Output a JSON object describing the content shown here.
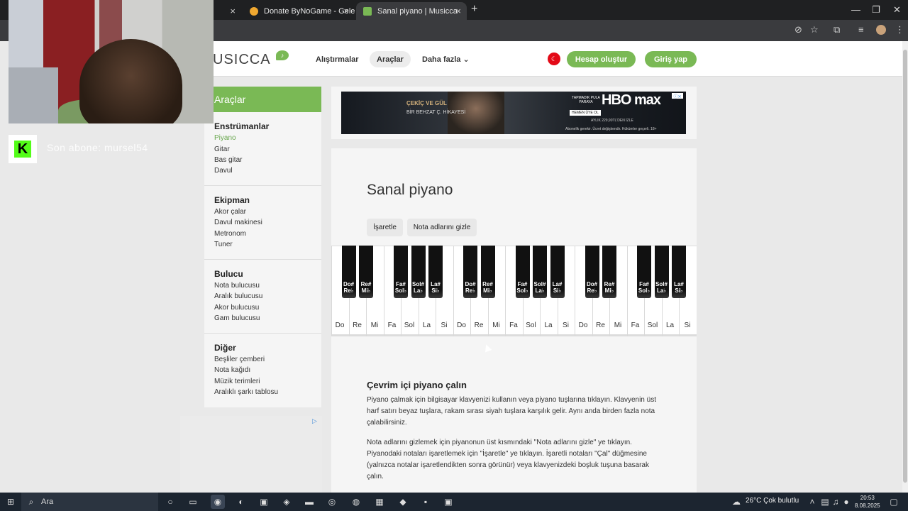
{
  "browser": {
    "tabs": [
      {
        "label": "",
        "active": false
      },
      {
        "label": "Donate ByNoGame - Gelen/Gi",
        "active": false
      },
      {
        "label": "Sanal piyano | Musicca",
        "active": true
      }
    ],
    "new_tab": "+",
    "close_glyph": "×",
    "window_controls": [
      "—",
      "❐",
      "✕"
    ]
  },
  "overlay": {
    "sub_label": "Son abone: mursel54",
    "kick_logo": "K"
  },
  "site": {
    "logo": "USICCA",
    "nav": [
      "Alıştırmalar",
      "Araçlar",
      "Daha fazla ⌄"
    ],
    "signup": "Hesap oluştur",
    "login": "Giriş yap"
  },
  "sidebar": {
    "title": "Araçlar",
    "sections": [
      {
        "title": "Enstrümanlar",
        "items": [
          "Piyano",
          "Gitar",
          "Bas gitar",
          "Davul"
        ]
      },
      {
        "title": "Ekipman",
        "items": [
          "Akor çalar",
          "Davul makinesi",
          "Metronom",
          "Tuner"
        ]
      },
      {
        "title": "Bulucu",
        "items": [
          "Nota bulucusu",
          "Aralık bulucusu",
          "Akor bulucusu",
          "Gam bulucusu"
        ]
      },
      {
        "title": "Diğer",
        "items": [
          "Beşliler çemberi",
          "Nota kağıdı",
          "Müzik terimleri",
          "Aralıklı şarkı tablosu"
        ]
      }
    ]
  },
  "ad": {
    "line1": "ÇEKİÇ VE GÜL",
    "line2": "BİR BEHZAT Ç. HİKAYESİ",
    "offer": "TAPMADIK PULA PARAYA",
    "cta": "HEMEN ÜYE OL",
    "brand": "HBO max",
    "price": "AYLIK 229,90TL'DEN İZLE",
    "disclaimer": "Abonelik gerekir. Ücret değişkendir. Hükümler geçerli. 18+"
  },
  "page": {
    "title": "Sanal piyano",
    "mark_button": "İşaretle",
    "hide_button": "Nota adlarını gizle",
    "white_keys": [
      "Do",
      "Re",
      "Mi",
      "Fa",
      "Sol",
      "La",
      "Si",
      "Do",
      "Re",
      "Mi",
      "Fa",
      "Sol",
      "La",
      "Si",
      "Do",
      "Re",
      "Mi",
      "Fa",
      "Sol",
      "La",
      "Si"
    ],
    "black_keys": [
      {
        "top": "Do#",
        "bottom": "Re♭"
      },
      {
        "top": "Re#",
        "bottom": "Mi♭"
      },
      {
        "top": "Fa#",
        "bottom": "Sol♭"
      },
      {
        "top": "Sol#",
        "bottom": "La♭"
      },
      {
        "top": "La#",
        "bottom": "Si♭"
      },
      {
        "top": "Do#",
        "bottom": "Re♭"
      },
      {
        "top": "Re#",
        "bottom": "Mi♭"
      },
      {
        "top": "Fa#",
        "bottom": "Sol♭"
      },
      {
        "top": "Sol#",
        "bottom": "La♭"
      },
      {
        "top": "La#",
        "bottom": "Si♭"
      },
      {
        "top": "Do#",
        "bottom": "Re♭"
      },
      {
        "top": "Re#",
        "bottom": "Mi♭"
      },
      {
        "top": "Fa#",
        "bottom": "Sol♭"
      },
      {
        "top": "Sol#",
        "bottom": "La♭"
      },
      {
        "top": "La#",
        "bottom": "Si♭"
      }
    ],
    "heading": "Çevrim içi piyano çalın",
    "para1": "Piyano çalmak için bilgisayar klavyenizi kullanın veya piyano tuşlarına tıklayın. Klavyenin üst harf satırı beyaz tuşlara, rakam sırası siyah tuşlara karşılık gelir. Aynı anda birden fazla nota çalabilirsiniz.",
    "para2": "Nota adlarını gizlemek için piyanonun üst kısmındaki \"Nota adlarını gizle\" ye tıklayın. Piyanodaki notaları işaretlemek için \"İşaretle\" ye tıklayın. İşaretli notaları \"Çal\" düğmesine (yalnızca notalar işaretlendikten sonra görünür) veya klavyenizdeki boşluk tuşuna basarak çalın."
  },
  "taskbar": {
    "search": "Ara",
    "weather": "26°C  Çok bulutlu",
    "time": "20:53",
    "date": "8.08.2025"
  },
  "colors": {
    "accent": "#7ab955",
    "tabbar": "#1f2022",
    "taskbar": "#1c2530"
  }
}
